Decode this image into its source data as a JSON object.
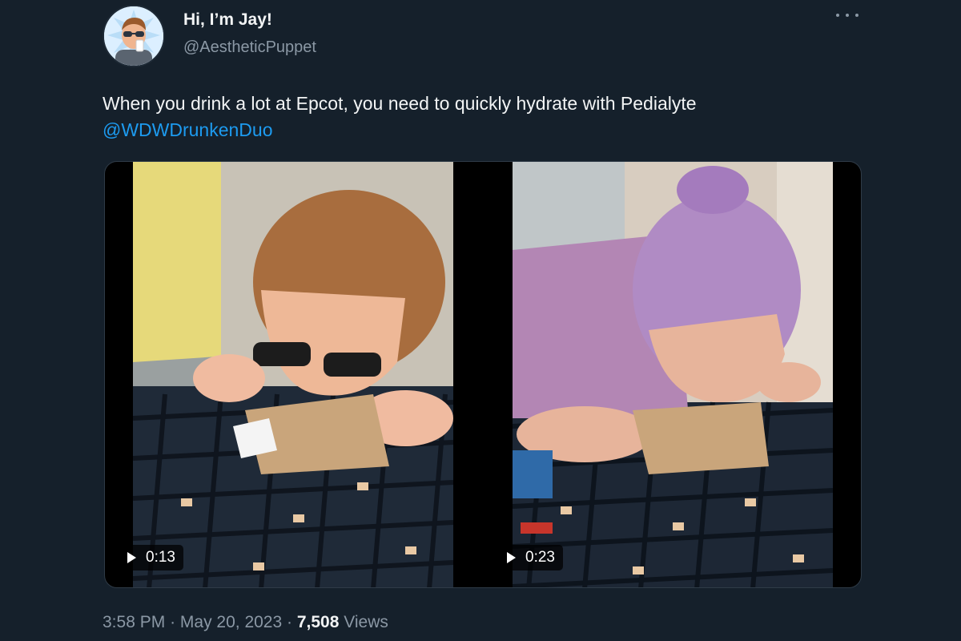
{
  "author": {
    "display_name": "Hi, I’m Jay!",
    "handle": "@AestheticPuppet",
    "avatar_icon": "cartoon-avatar-icon"
  },
  "tweet": {
    "text": "When you drink a lot at Epcot, you need to quickly hydrate with Pedialyte",
    "mention": "@WDWDrunkenDuo"
  },
  "media": {
    "videos": [
      {
        "duration": "0:13"
      },
      {
        "duration": "0:23"
      }
    ]
  },
  "meta": {
    "time": "3:58 PM",
    "separator": "·",
    "date": "May 20, 2023",
    "views_count": "7,508",
    "views_label": "Views"
  },
  "colors": {
    "background": "#15202b",
    "accent": "#1d9bf0",
    "secondary_text": "#8b98a5"
  }
}
